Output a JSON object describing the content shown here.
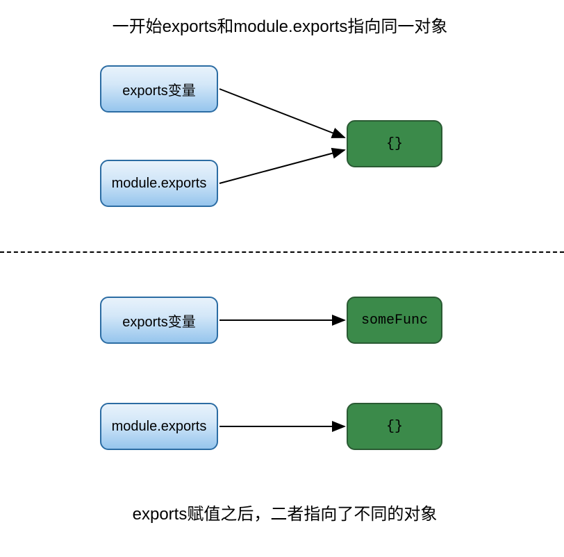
{
  "titles": {
    "top": "一开始exports和module.exports指向同一对象",
    "bottom": "exports赋值之后，二者指向了不同的对象"
  },
  "boxes": {
    "top_exports": "exports变量",
    "top_module": "module.exports",
    "top_object": "{}",
    "bottom_exports": "exports变量",
    "bottom_module": "module.exports",
    "bottom_somefunc": "someFunc",
    "bottom_object": "{}"
  }
}
